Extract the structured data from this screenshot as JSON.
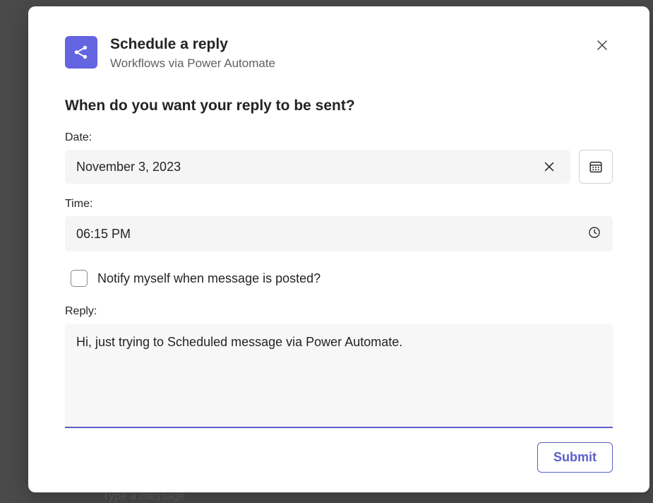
{
  "dialog": {
    "title": "Schedule a reply",
    "subtitle": "Workflows via Power Automate",
    "heading": "When do you want your reply to be sent?"
  },
  "fields": {
    "date_label": "Date:",
    "date_value": "November 3, 2023",
    "time_label": "Time:",
    "time_value": "06:15 PM",
    "notify_label": "Notify myself when message is posted?",
    "reply_label": "Reply:",
    "reply_value": "Hi, just trying to Scheduled message via Power Automate."
  },
  "footer": {
    "submit_label": "Submit"
  },
  "icons": {
    "app": "share-icon",
    "close": "close-icon",
    "clear": "clear-icon",
    "calendar": "calendar-icon",
    "clock": "clock-icon"
  },
  "colors": {
    "accent": "#5b5fc7",
    "app_icon_bg": "#6264e0"
  },
  "background": {
    "compose_hint": "Type a message"
  }
}
